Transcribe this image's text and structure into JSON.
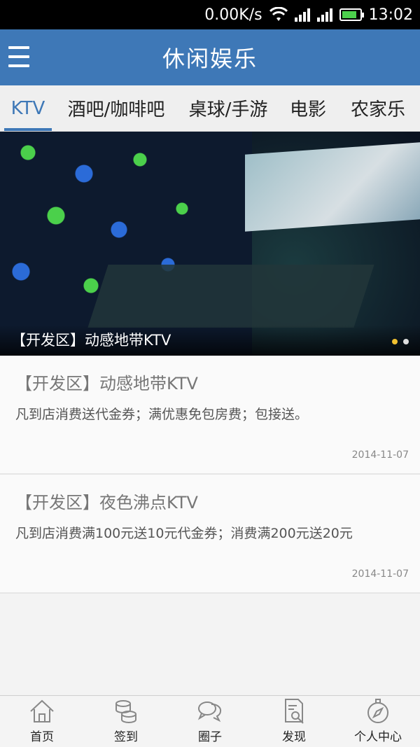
{
  "status_bar": {
    "speed": "0.00K/s",
    "time": "13:02",
    "battery_fill": 0.85
  },
  "header": {
    "title": "休闲娱乐",
    "menu_icon": "menu-icon"
  },
  "tabs": [
    {
      "label": "KTV",
      "active": true
    },
    {
      "label": "酒吧/咖啡吧"
    },
    {
      "label": "桌球/手游"
    },
    {
      "label": "电影"
    },
    {
      "label": "农家乐"
    }
  ],
  "banner": {
    "caption": "【开发区】动感地带KTV",
    "dot_count": 2,
    "active_dot": 0
  },
  "items": [
    {
      "title": "【开发区】动感地带KTV",
      "desc": "凡到店消费送代金券；满优惠免包房费；包接送。",
      "date": "2014-11-07"
    },
    {
      "title": "【开发区】夜色沸点KTV",
      "desc": "凡到店消费满100元送10元代金券；消费满200元送20元",
      "date": "2014-11-07"
    }
  ],
  "bottom_nav": [
    {
      "label": "首页",
      "icon": "home-icon"
    },
    {
      "label": "签到",
      "icon": "coins-icon"
    },
    {
      "label": "圈子",
      "icon": "chat-bubbles-icon"
    },
    {
      "label": "发现",
      "icon": "document-search-icon"
    },
    {
      "label": "个人中心",
      "icon": "compass-icon"
    }
  ],
  "colors": {
    "accent": "#3e78b7",
    "status_bar": "#000000",
    "dot_active": "#f0c030"
  }
}
